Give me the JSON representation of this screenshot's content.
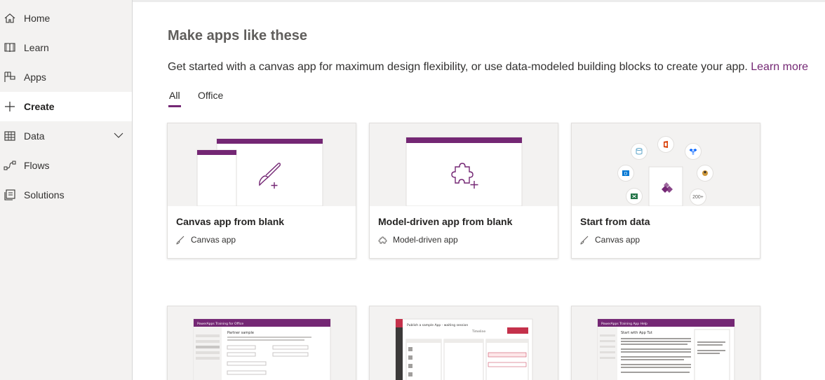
{
  "sidebar": {
    "items": [
      {
        "label": "Home",
        "icon": "home-icon"
      },
      {
        "label": "Learn",
        "icon": "book-icon"
      },
      {
        "label": "Apps",
        "icon": "apps-icon"
      },
      {
        "label": "Create",
        "icon": "plus-icon",
        "active": true
      },
      {
        "label": "Data",
        "icon": "table-icon",
        "expandable": true
      },
      {
        "label": "Flows",
        "icon": "flow-icon"
      },
      {
        "label": "Solutions",
        "icon": "solutions-icon"
      }
    ]
  },
  "main": {
    "title": "Make apps like these",
    "subtitle": "Get started with a canvas app for maximum design flexibility, or use data-modeled building blocks to create your app.",
    "subtitle_link": "Learn more",
    "tabs": [
      {
        "label": "All",
        "selected": true
      },
      {
        "label": "Office",
        "selected": false
      }
    ],
    "cards": [
      {
        "title": "Canvas app from blank",
        "type_label": "Canvas app",
        "type_icon": "brush-icon"
      },
      {
        "title": "Model-driven app from blank",
        "type_label": "Model-driven app",
        "type_icon": "puzzle-icon"
      },
      {
        "title": "Start from data",
        "type_label": "Canvas app",
        "type_icon": "brush-icon",
        "data_count": "200+"
      }
    ],
    "templates": [
      {
        "header": "PowerApps Training for Office",
        "section": "Partner sample"
      },
      {
        "header": "Publish a sample App - waiting session",
        "section": "Timeline"
      },
      {
        "header": "PowerApps Training App Help",
        "section": "Start with App Tut"
      }
    ]
  },
  "colors": {
    "accent": "#742774",
    "sidebar_bg": "#f3f2f1",
    "card_border": "#e1dfdd"
  }
}
